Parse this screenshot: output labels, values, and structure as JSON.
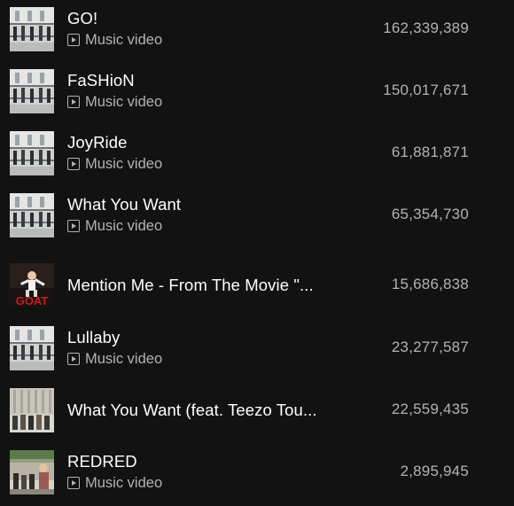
{
  "tracks": [
    {
      "title": "GO!",
      "subtitle": "Music video",
      "plays": "162,339,389",
      "art": "building-group"
    },
    {
      "title": "FaSHioN",
      "subtitle": "Music video",
      "plays": "150,017,671",
      "art": "building-group"
    },
    {
      "title": "JoyRide",
      "subtitle": "Music video",
      "plays": "61,881,871",
      "art": "building-group"
    },
    {
      "title": "What You Want",
      "subtitle": "Music video",
      "plays": "65,354,730",
      "art": "building-group"
    },
    {
      "title": "Mention Me - From The Movie \"...",
      "subtitle": "",
      "plays": "15,686,838",
      "art": "goat-poster"
    },
    {
      "title": "Lullaby",
      "subtitle": "Music video",
      "plays": "23,277,587",
      "art": "building-group"
    },
    {
      "title": "What You Want (feat. Teezo Tou...",
      "subtitle": "",
      "plays": "22,559,435",
      "art": "street-group"
    },
    {
      "title": "REDRED",
      "subtitle": "Music video",
      "plays": "2,895,945",
      "art": "train-station"
    }
  ],
  "art_logo_text": "GOAT",
  "colors": {
    "background": "#121212",
    "text": "#ffffff",
    "muted": "#b3b3b3"
  }
}
